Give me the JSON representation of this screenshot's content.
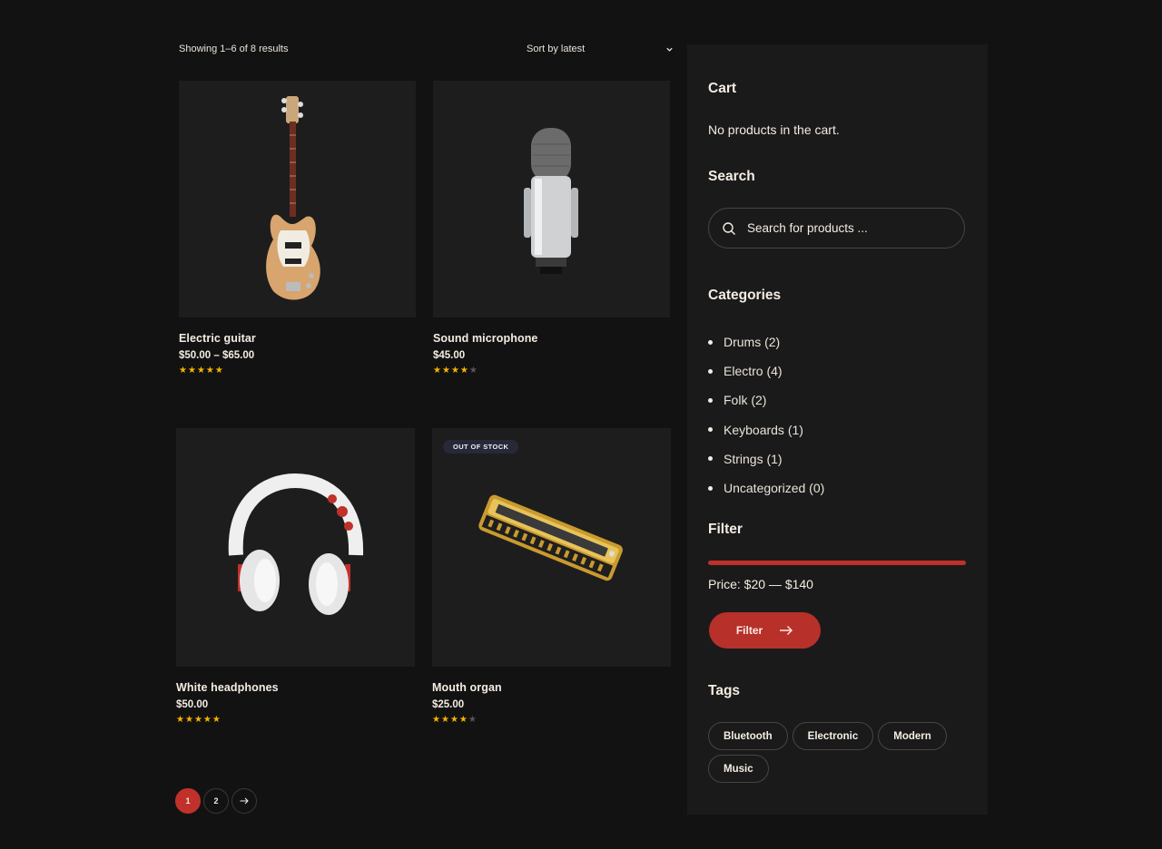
{
  "results": {
    "count_text": "Showing 1–6 of 8 results",
    "sort_label": "Sort by latest"
  },
  "products": [
    {
      "name": "Electric guitar",
      "price": "$50.00 – $65.00",
      "rating": 5,
      "rating_max": 5,
      "badge": ""
    },
    {
      "name": "Sound microphone",
      "price": "$45.00",
      "rating": 4,
      "rating_max": 5,
      "badge": ""
    },
    {
      "name": "White headphones",
      "price": "$50.00",
      "rating": 5,
      "rating_max": 5,
      "badge": ""
    },
    {
      "name": "Mouth organ",
      "price": "$25.00",
      "rating": 4,
      "rating_max": 5,
      "badge": "OUT OF STOCK"
    }
  ],
  "pagination": {
    "pages": [
      "1",
      "2"
    ],
    "current": "1",
    "next_icon": "arrow-right-icon"
  },
  "sidebar": {
    "cart": {
      "title": "Cart",
      "empty_text": "No products in the cart."
    },
    "search": {
      "title": "Search",
      "placeholder": "Search for products ...",
      "icon": "search-icon"
    },
    "categories": {
      "title": "Categories",
      "items": [
        {
          "label": "Drums (2)"
        },
        {
          "label": "Electro (4)"
        },
        {
          "label": "Folk (2)"
        },
        {
          "label": "Keyboards (1)"
        },
        {
          "label": "Strings (1)"
        },
        {
          "label": "Uncategorized (0)"
        }
      ]
    },
    "filter": {
      "title": "Filter",
      "price_text": "Price: $20 — $140",
      "button_label": "Filter",
      "accent": "#c0312b"
    },
    "tags": {
      "title": "Tags",
      "items": [
        "Bluetooth",
        "Electronic",
        "Modern",
        "Music"
      ]
    }
  },
  "colors": {
    "background": "#131212",
    "panel": "#1b1a1a",
    "accent": "#c0312b",
    "star": "#f5b400"
  }
}
